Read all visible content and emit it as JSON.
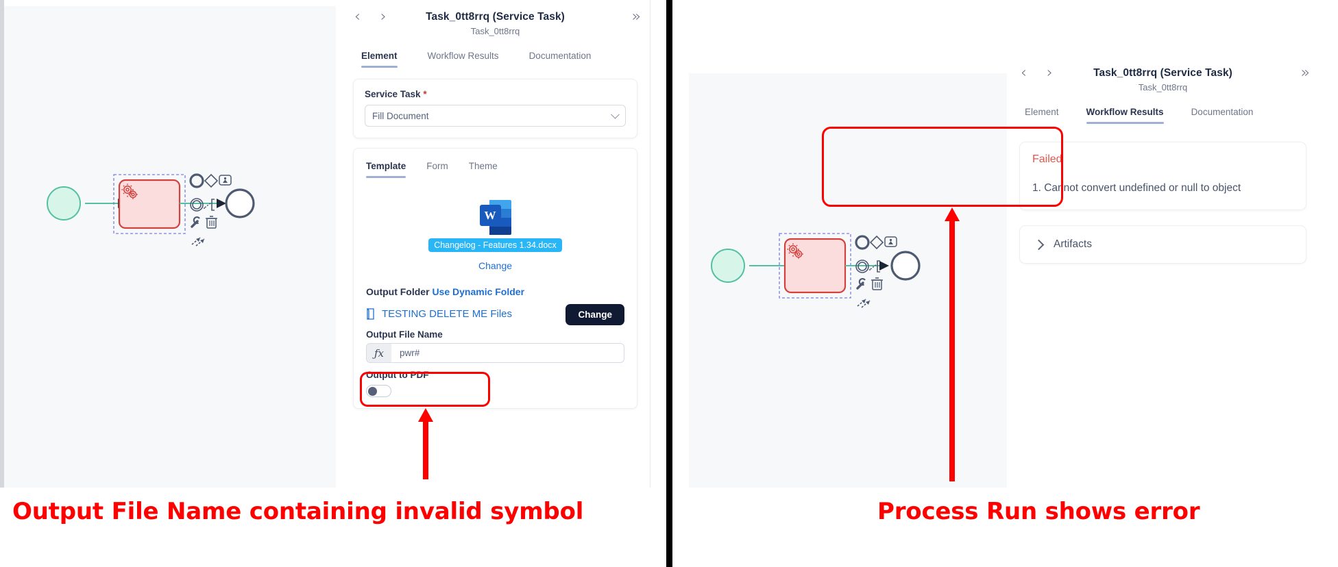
{
  "annotations": {
    "left_caption": "Output File Name containing invalid symbol",
    "right_caption": "Process Run shows error",
    "highlight_color": "#ff0000"
  },
  "left_panel": {
    "header": {
      "title": "Task_0tt8rrq (Service Task)",
      "subtitle": "Task_0tt8rrq",
      "prev_icon": "chevron-left-icon",
      "next_icon": "chevron-right-icon",
      "expand_icon": "double-chevron-right-icon"
    },
    "tabs": [
      {
        "label": "Element",
        "active": true
      },
      {
        "label": "Workflow Results",
        "active": false
      },
      {
        "label": "Documentation",
        "active": false
      }
    ],
    "service_task": {
      "label": "Service Task",
      "required_marker": "*",
      "selected": "Fill Document",
      "chevron_icon": "chevron-down-icon"
    },
    "template_tabs": [
      {
        "label": "Template",
        "active": true
      },
      {
        "label": "Form",
        "active": false
      },
      {
        "label": "Theme",
        "active": false
      }
    ],
    "template": {
      "file_icon": "word-document-icon",
      "file_icon_letter": "W",
      "file_name": "Changelog - Features 1.34.docx",
      "change_link": "Change"
    },
    "output_folder": {
      "label": "Output Folder",
      "dynamic_link": "Use Dynamic Folder",
      "folder_icon": "folder-icon",
      "folder_name": "TESTING DELETE ME Files",
      "change_button": "Change"
    },
    "output_file_name": {
      "label": "Output File Name",
      "fx_label": "ƒx",
      "value": "pwr#"
    },
    "output_to_pdf": {
      "label": "Output to PDF",
      "enabled": false
    }
  },
  "right_panel": {
    "header": {
      "title": "Task_0tt8rrq (Service Task)",
      "subtitle": "Task_0tt8rrq",
      "prev_icon": "chevron-left-icon",
      "next_icon": "chevron-right-icon",
      "expand_icon": "double-chevron-right-icon"
    },
    "tabs": [
      {
        "label": "Element",
        "active": false
      },
      {
        "label": "Workflow Results",
        "active": true
      },
      {
        "label": "Documentation",
        "active": false
      }
    ],
    "result": {
      "status": "Failed",
      "status_color": "#e2574c",
      "message": "1. Cannot convert undefined or null to object"
    },
    "artifacts": {
      "label": "Artifacts",
      "expand_icon": "chevron-right-icon"
    }
  },
  "diagram": {
    "start_event": "start-event",
    "task": "service-task-selected",
    "task_icon": "gears-icon",
    "end_event": "end-event",
    "context_pad": [
      "append-end-event-icon",
      "append-gateway-icon",
      "append-task-icon",
      "append-intermediate-event-icon",
      "append-text-annotation-icon",
      "wrench-icon",
      "trash-icon",
      "connect-icon"
    ]
  }
}
